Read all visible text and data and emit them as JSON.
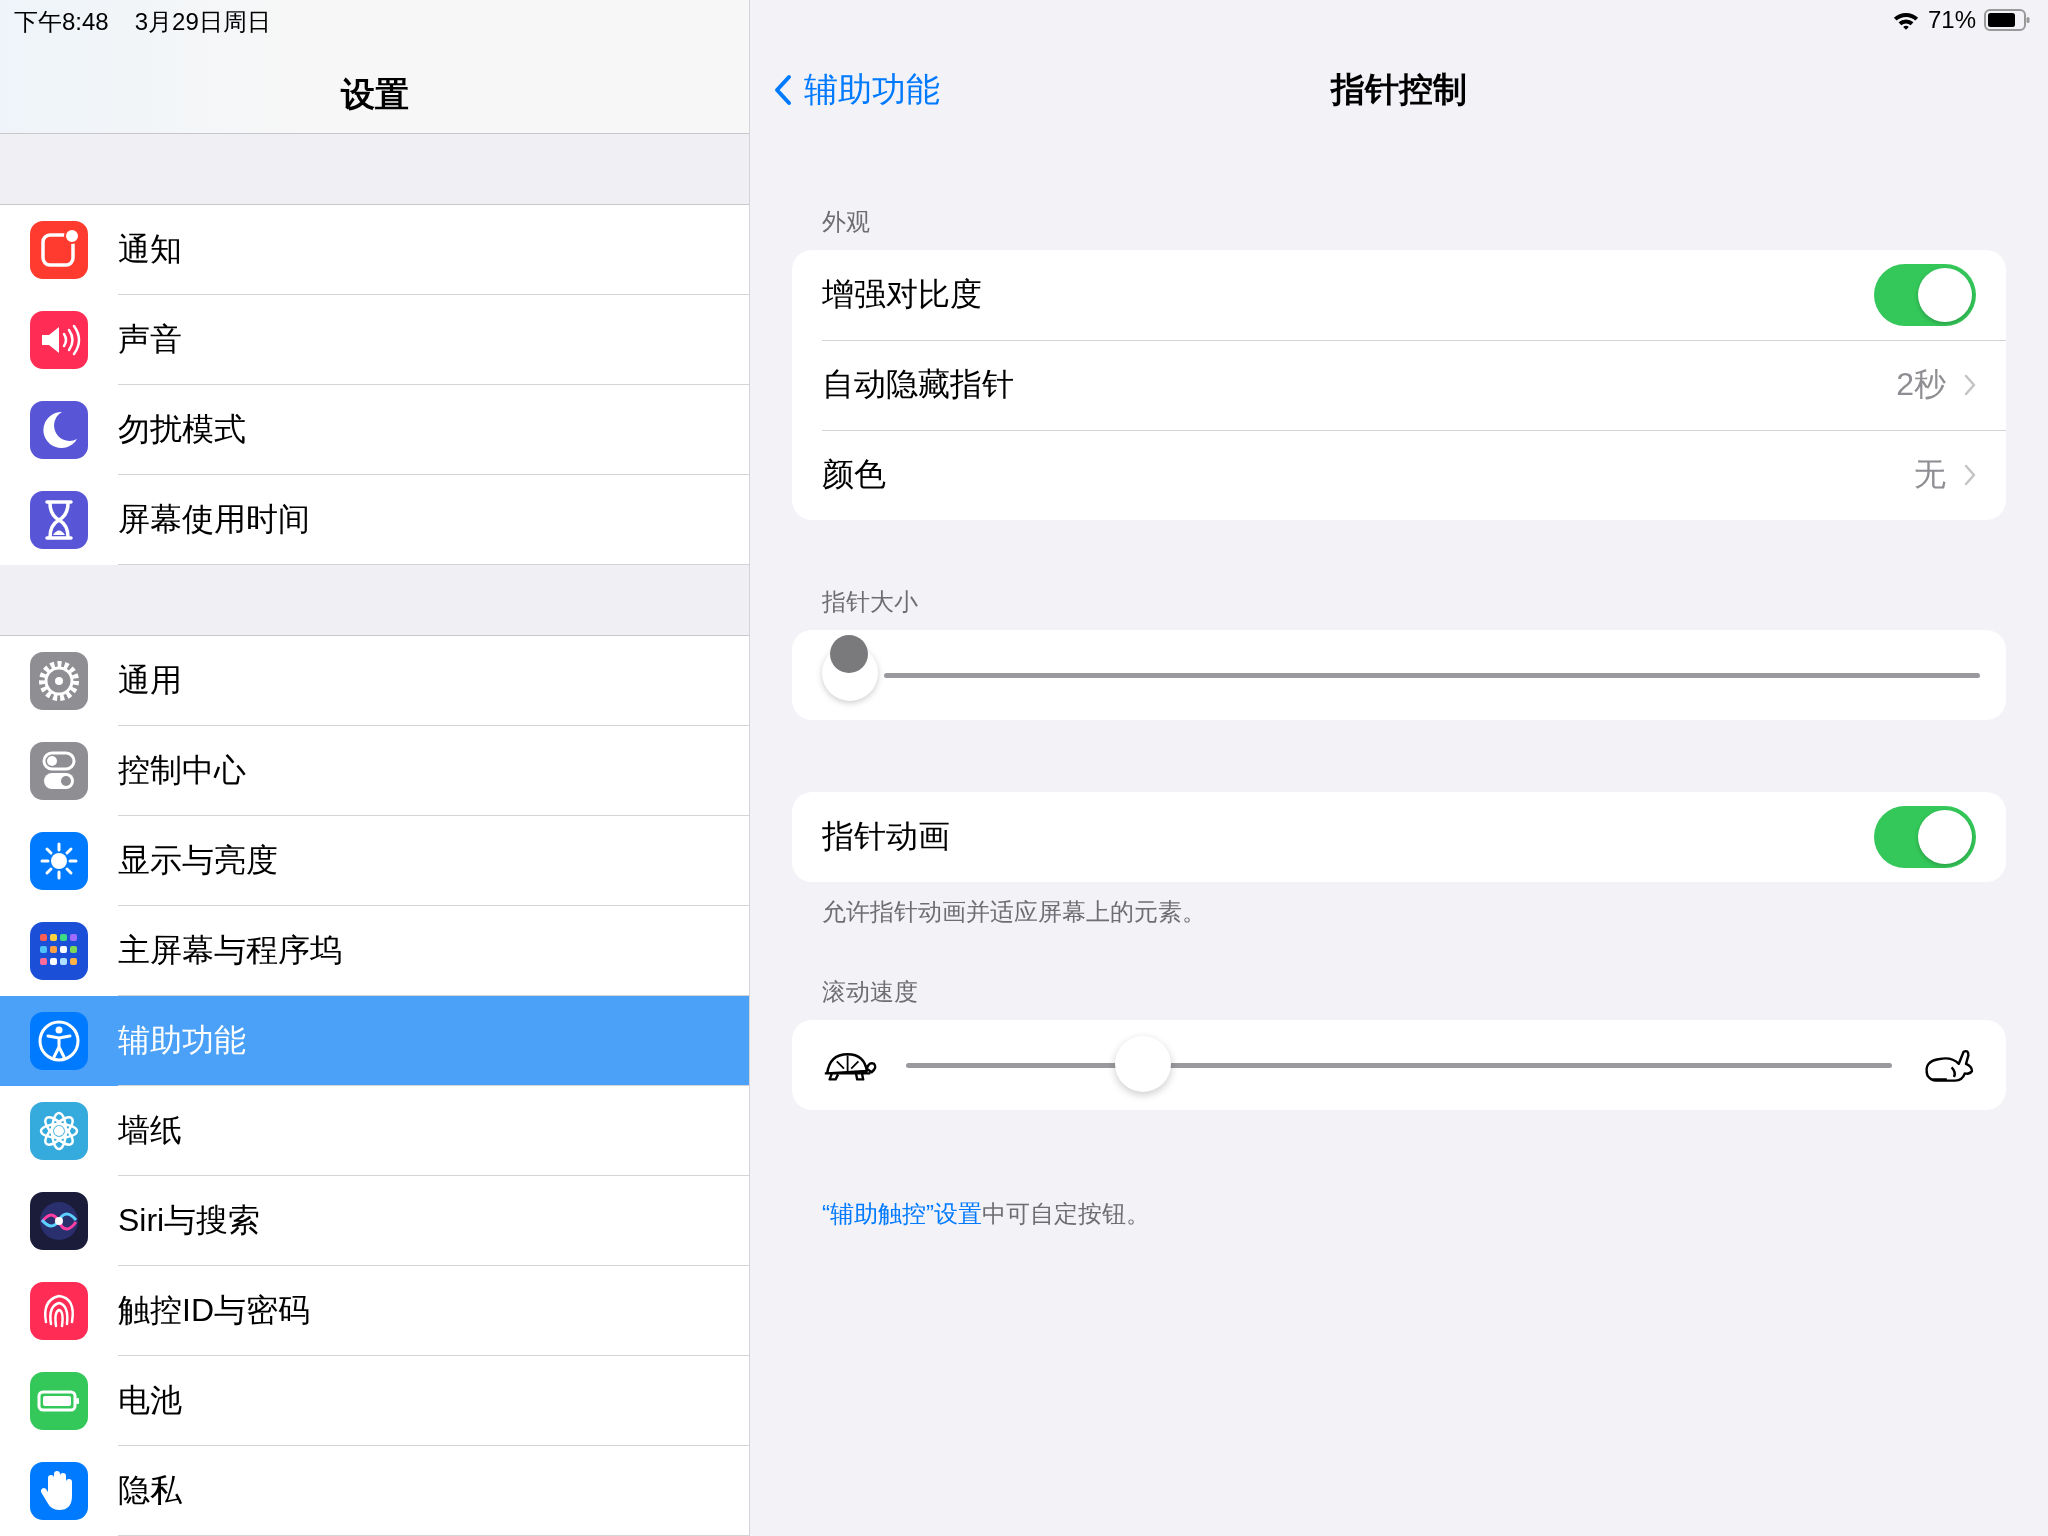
{
  "status_bar": {
    "time": "下午8:48",
    "date": "3月29日周日",
    "battery": "71%"
  },
  "sidebar": {
    "title": "设置",
    "groups": [
      {
        "items": [
          {
            "label": "通知",
            "selected": false
          },
          {
            "label": "声音",
            "selected": false
          },
          {
            "label": "勿扰模式",
            "selected": false
          },
          {
            "label": "屏幕使用时间",
            "selected": false
          }
        ]
      },
      {
        "items": [
          {
            "label": "通用",
            "selected": false
          },
          {
            "label": "控制中心",
            "selected": false
          },
          {
            "label": "显示与亮度",
            "selected": false
          },
          {
            "label": "主屏幕与程序坞",
            "selected": false
          },
          {
            "label": "辅助功能",
            "selected": true
          },
          {
            "label": "墙纸",
            "selected": false
          },
          {
            "label": "Siri与搜索",
            "selected": false
          },
          {
            "label": "触控ID与密码",
            "selected": false
          },
          {
            "label": "电池",
            "selected": false
          },
          {
            "label": "隐私",
            "selected": false
          }
        ]
      }
    ]
  },
  "detail": {
    "back": "辅助功能",
    "title": "指针控制",
    "sections": [
      {
        "header": "外观",
        "rows": [
          {
            "kind": "toggle",
            "label": "增强对比度",
            "on": true
          },
          {
            "kind": "detail",
            "label": "自动隐藏指针",
            "value": "2秒"
          },
          {
            "kind": "detail",
            "label": "颜色",
            "value": "无"
          }
        ]
      },
      {
        "header": "指针大小",
        "rows": [
          {
            "kind": "pointer_slider",
            "level": 0
          }
        ]
      },
      {
        "rows": [
          {
            "kind": "toggle",
            "label": "指针动画",
            "on": true
          }
        ],
        "footer": "允许指针动画并适应屏幕上的元素。"
      },
      {
        "header": "滚动速度",
        "rows": [
          {
            "kind": "speed_slider",
            "level": 0.24
          }
        ]
      }
    ],
    "note": {
      "link": "“辅助触控”设置",
      "text": "中可自定按钮。"
    }
  }
}
